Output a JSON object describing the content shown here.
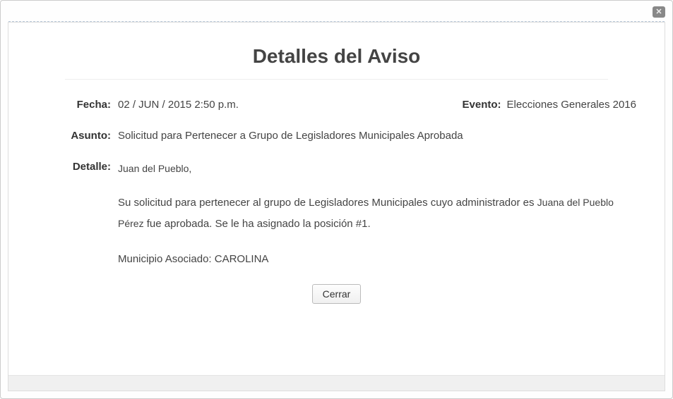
{
  "title": "Detalles del Aviso",
  "labels": {
    "fecha": "Fecha:",
    "evento": "Evento:",
    "asunto": "Asunto:",
    "detalle": "Detalle:"
  },
  "values": {
    "fecha": "02 / JUN / 2015 2:50 p.m.",
    "evento": "Elecciones Generales 2016",
    "asunto": "Solicitud para Pertenecer a Grupo de Legisladores Municipales Aprobada"
  },
  "detail": {
    "greeting": "Juan del Pueblo,",
    "line_prefix": "Su solicitud para pertenecer al grupo de Legisladores Municipales cuyo administrador es ",
    "admin_name": "Juana del Pueblo Pérez",
    "line_suffix": "   fue aprobada. Se le ha asignado la posición #1.",
    "municipio": "Municipio Asociado: CAROLINA"
  },
  "buttons": {
    "close": "Cerrar"
  },
  "close_icon_glyph": "✕"
}
